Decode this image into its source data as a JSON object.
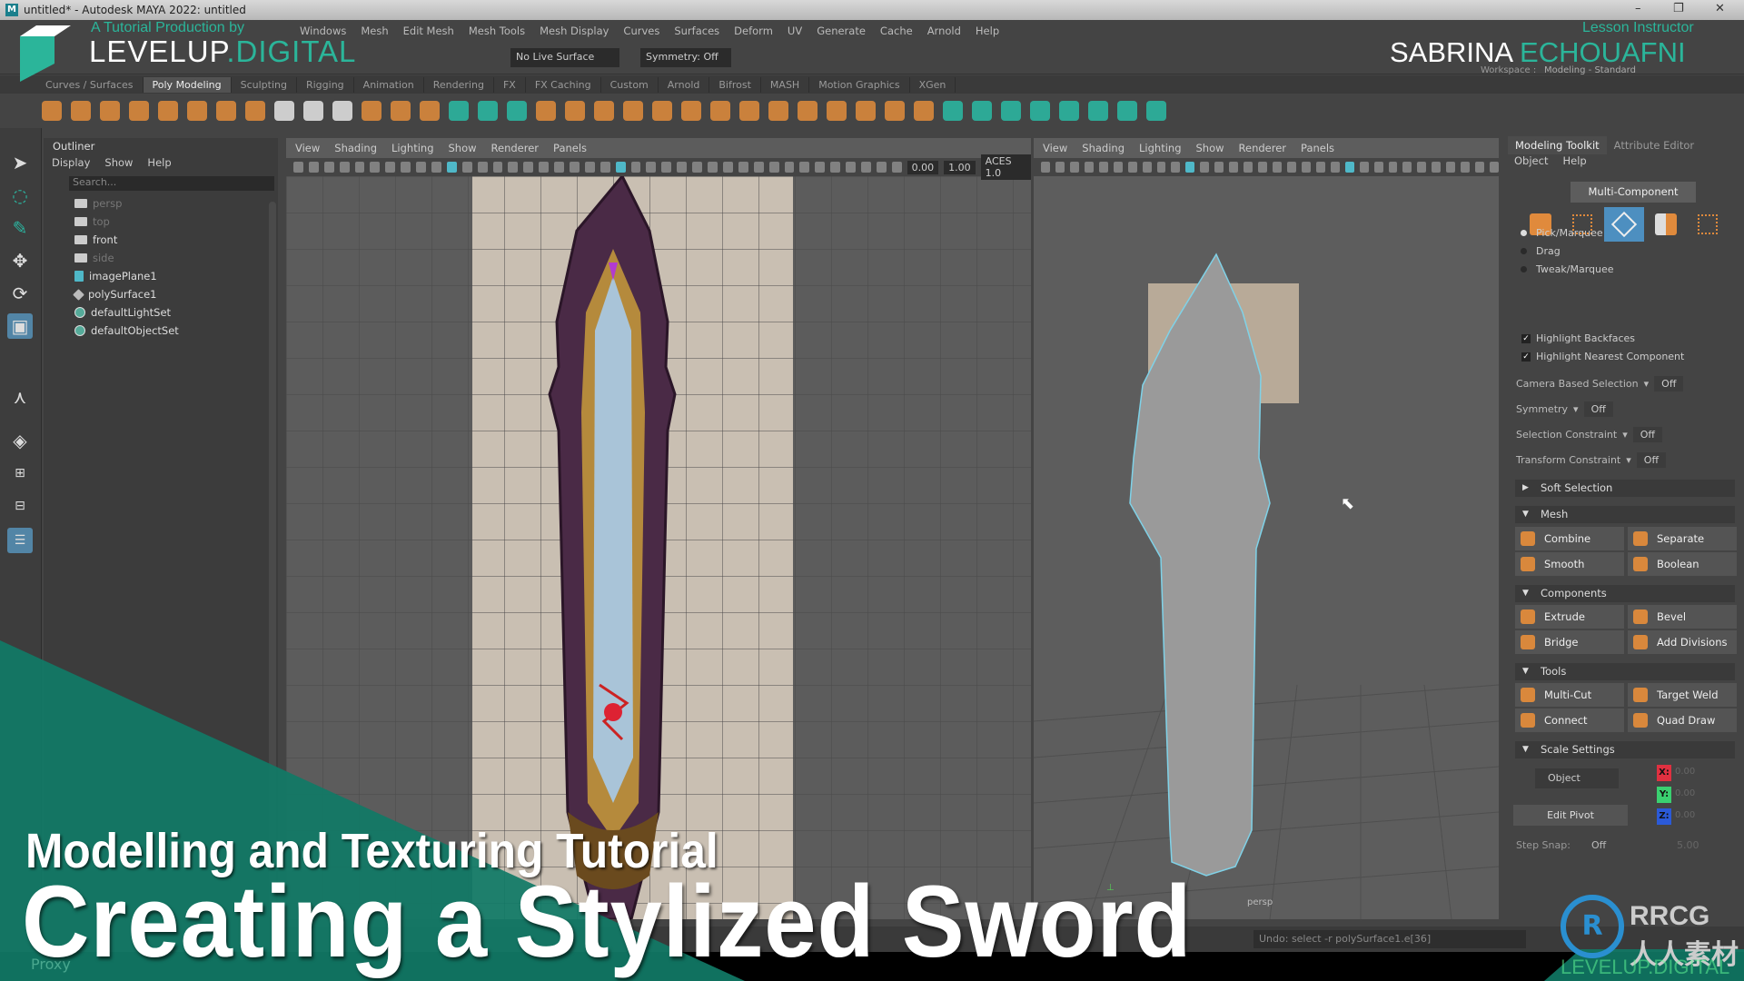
{
  "window": {
    "title": "untitled* - Autodesk MAYA 2022: untitled",
    "minimize": "–",
    "restore": "❐",
    "close": "✕"
  },
  "menubar": {
    "items": [
      "Windows",
      "Mesh",
      "Edit Mesh",
      "Mesh Tools",
      "Mesh Display",
      "Curves",
      "Surfaces",
      "Deform",
      "UV",
      "Generate",
      "Cache",
      "Arnold",
      "Help"
    ]
  },
  "statusline": {
    "live_surface": "No Live Surface",
    "symmetry": "Symmetry: Off",
    "workspace_label": "Workspace :",
    "workspace_value": "Modeling - Standard"
  },
  "shelf": {
    "tabs": [
      "Curves / Surfaces",
      "Poly Modeling",
      "Sculpting",
      "Rigging",
      "Animation",
      "Rendering",
      "FX",
      "FX Caching",
      "Custom",
      "Arnold",
      "Bifrost",
      "MASH",
      "Motion Graphics",
      "XGen"
    ],
    "active": "Poly Modeling"
  },
  "outliner": {
    "title": "Outliner",
    "menu": [
      "Display",
      "Show",
      "Help"
    ],
    "search_placeholder": "Search...",
    "items": [
      {
        "label": "persp",
        "icon": "camera-icon",
        "dim": true
      },
      {
        "label": "top",
        "icon": "camera-icon",
        "dim": true
      },
      {
        "label": "front",
        "icon": "camera-icon",
        "dim": false
      },
      {
        "label": "side",
        "icon": "camera-icon",
        "dim": true
      },
      {
        "label": "imagePlane1",
        "icon": "image-plane-icon",
        "dim": false
      },
      {
        "label": "polySurface1",
        "icon": "poly-icon",
        "dim": false
      },
      {
        "label": "defaultLightSet",
        "icon": "set-icon",
        "dim": false
      },
      {
        "label": "defaultObjectSet",
        "icon": "set-icon",
        "dim": false
      }
    ]
  },
  "viewport_left": {
    "menu": [
      "View",
      "Shading",
      "Lighting",
      "Show",
      "Renderer",
      "Panels"
    ],
    "exposure": "0.00",
    "gamma": "1.00",
    "color_space": "ACES 1.0"
  },
  "viewport_right": {
    "menu": [
      "View",
      "Shading",
      "Lighting",
      "Show",
      "Renderer",
      "Panels"
    ],
    "camera_label": "persp"
  },
  "toolkit": {
    "tabs": [
      "Modeling Toolkit",
      "Attribute Editor"
    ],
    "menu": [
      "Object",
      "Help"
    ],
    "multi_component": "Multi-Component",
    "selection_modes": [
      {
        "label": "Pick/Marquee",
        "on": true
      },
      {
        "label": "Drag",
        "on": false
      },
      {
        "label": "Tweak/Marquee",
        "on": false
      }
    ],
    "checks": [
      {
        "label": "Highlight Backfaces",
        "checked": true
      },
      {
        "label": "Highlight Nearest Component",
        "checked": true
      }
    ],
    "options": [
      {
        "label": "Camera Based Selection",
        "value": "Off"
      },
      {
        "label": "Symmetry",
        "value": "Off"
      },
      {
        "label": "Selection Constraint",
        "value": "Off"
      },
      {
        "label": "Transform Constraint",
        "value": "Off"
      }
    ],
    "soft_selection": "Soft Selection",
    "sections": {
      "mesh": "Mesh",
      "components": "Components",
      "tools": "Tools",
      "scale": "Scale Settings"
    },
    "mesh_buttons": [
      "Combine",
      "Separate",
      "Smooth",
      "Boolean"
    ],
    "component_buttons": [
      "Extrude",
      "Bevel",
      "Bridge",
      "Add Divisions"
    ],
    "tool_buttons": [
      "Multi-Cut",
      "Target Weld",
      "Connect",
      "Quad Draw"
    ],
    "scale": {
      "space": "Object",
      "edit_pivot": "Edit Pivot",
      "x_label": "X:",
      "y_label": "Y:",
      "z_label": "Z:",
      "x": "0.00",
      "y": "0.00",
      "z": "0.00",
      "step_snap_label": "Step Snap:",
      "step_snap": "Off",
      "step_value": "5.00"
    }
  },
  "statusbar": {
    "message": "Undo: select -r polySurface1.e[36]",
    "proxy": "Proxy"
  },
  "overlay": {
    "producer_line": "A Tutorial Production by",
    "brand_a": "LEVELUP",
    "brand_b": ".DIGITAL",
    "instructor_label": "Lesson Instructor",
    "instructor_first": "SABRINA",
    "instructor_last": "ECHOUAFNI",
    "subtitle": "Modelling and Texturing Tutorial",
    "title": "Creating a Stylized Sword",
    "watermark": "RRCG 人人素材",
    "footer_brand": "LEVELUP.DIGITAL"
  },
  "colors": {
    "accent_teal": "#2bb59a",
    "maya_select": "#5285a6",
    "orange_icon": "#d9883c"
  }
}
